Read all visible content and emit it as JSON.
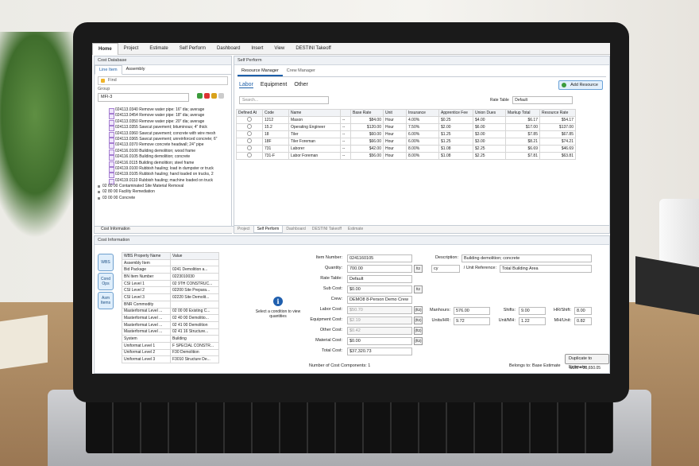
{
  "ribbon": {
    "tabs": [
      "Home",
      "Project",
      "Estimate",
      "Self Perform",
      "Dashboard",
      "Insert",
      "View",
      "DESTINI Takeoff"
    ],
    "active": "Home"
  },
  "cost_database": {
    "title": "Cost Database",
    "tabs": [
      "Line Item",
      "Assembly"
    ],
    "find_label": "Find",
    "group_label": "Group",
    "group_value": "MFI-3",
    "tree": [
      "024113.0340 Remove water pipe: 16\" dia; average",
      "024113.0454 Remove water pipe: 18\" dia; average",
      "024113.0350 Remove water pipe: 20\" dia; average",
      "024113.0355 Sawcut pavement; bituminous; 4\" thick",
      "024113.0360 Sawcut pavement; concrete with wire mesh",
      "024113.0365 Sawcut pavement; unreinforced concrete; 6\"",
      "024113.0370 Remove concrete headwall; 24\" pipe",
      "024116.0100 Building demolition; wood frame",
      "024116.0105 Building demolition; concrete",
      "024116.0115 Building demolition; steel frame",
      "024119.0100 Rubbish hauling; load in dumpster or truck",
      "024119.0105 Rubbish hauling; hand loaded on trucks, 2",
      "024119.0110 Rubbish hauling; machine loaded on truck"
    ],
    "folders": [
      "02 60 00 Contaminated Site Material Removal",
      "02 80 00 Facility Remediation",
      "03 00 00 Concrete"
    ],
    "footer": "Cost Information"
  },
  "self_perform": {
    "title": "Self Perform",
    "tabs": [
      "Resource Manager",
      "Crew Manager"
    ],
    "categories": [
      "Labor",
      "Equipment",
      "Other"
    ],
    "add_resource": "Add Resource",
    "search_placeholder": "Search...",
    "rate_table_label": "Rate Table",
    "rate_table_value": "Default",
    "columns": [
      "Defined At",
      "Code",
      "Name",
      "",
      "Base Rate",
      "Unit",
      "Insurance",
      "Apprentice Fee",
      "Union Dues",
      "Markup Total",
      "Resource Rate"
    ],
    "rows": [
      [
        "",
        "1212",
        "Mason",
        "--",
        "$84.00",
        "Hour",
        "4.00%",
        "$0.25",
        "$4.00",
        "$6.17",
        "$54.17"
      ],
      [
        "",
        "15.2",
        "Operating Engineer",
        "--",
        "$120.00",
        "Hour",
        "7.50%",
        "$2.00",
        "$6.00",
        "$17.00",
        "$137.00"
      ],
      [
        "",
        "18",
        "Tiler",
        "--",
        "$60.00",
        "Hour",
        "6.00%",
        "$1.25",
        "$3.00",
        "$7.85",
        "$67.85"
      ],
      [
        "",
        "18F",
        "Tiler Foreman",
        "--",
        "$66.00",
        "Hour",
        "6.00%",
        "$1.25",
        "$3.00",
        "$8.21",
        "$74.21"
      ],
      [
        "",
        "731",
        "Laborer",
        "--",
        "$42.00",
        "Hour",
        "8.00%",
        "$1.08",
        "$2.25",
        "$6.69",
        "$46.69"
      ],
      [
        "",
        "731-F",
        "Labor Foreman",
        "--",
        "$56.00",
        "Hour",
        "8.00%",
        "$1.08",
        "$2.25",
        "$7.81",
        "$63.81"
      ]
    ],
    "bottom_tabs": [
      "Project",
      "Self Perform",
      "Dashboard",
      "DESTINI Takeoff",
      "Estimate"
    ]
  },
  "cost_information": {
    "title": "Cost Information",
    "side_buttons": [
      "WBS",
      "Cond Ops",
      "Asm Items"
    ],
    "wbs_columns": [
      "WBS Property Name",
      "Value"
    ],
    "wbs_rows": [
      [
        "Assembly Item",
        ""
      ],
      [
        "Bid Package",
        "0241 Demolition a..."
      ],
      [
        "BN Item Number",
        "0223010030"
      ],
      [
        "CSI Level 1",
        "02 9TH CONSTRUC..."
      ],
      [
        "CSI Level 2",
        "02200 Site Prepara..."
      ],
      [
        "CSI Level 3",
        "02220 Site Demolit..."
      ],
      [
        "BNR Commodity",
        ""
      ],
      [
        "Masterformat Level ...",
        "02 00 00 Existing C..."
      ],
      [
        "Masterformat Level ...",
        "02 40 00 Demolitio..."
      ],
      [
        "Masterformat Level ...",
        "02 41 00 Demolition"
      ],
      [
        "Masterformat Level ...",
        "02 41 16 Structure..."
      ],
      [
        "System",
        "Building"
      ],
      [
        "Uniformat Level 1",
        "F SPECIAL CONSTR..."
      ],
      [
        "Uniformat Level 2",
        "F30 Demolition"
      ],
      [
        "Uniformat Level 3",
        "F3010 Structure De..."
      ]
    ],
    "condition_prompt": "Select a condition to view quantities",
    "item_number_label": "Item Number:",
    "item_number": "0241160105",
    "quantity_label": "Quantity:",
    "quantity": "700.00",
    "quantity_unit": "ft2",
    "rate_table_label": "Rate Table:",
    "rate_table": "Default",
    "sub_cost_label": "Sub Cost:",
    "sub_cost": "$0.00",
    "sub_cost_unit": "ft2",
    "crew_label": "Crew:",
    "crew": "DEMO8 8-Person Demo Crew",
    "labor_cost_label": "Labor Cost:",
    "labor_cost": "$50.70",
    "equipment_cost_label": "Equipment Cost:",
    "equipment_cost": "$2.19",
    "other_cost_label": "Other Cost:",
    "other_cost": "$0.42",
    "material_cost_label": "Material Cost:",
    "material_cost": "$0.00",
    "total_cost_label": "Total Cost:",
    "total_cost": "$37,320.73",
    "cost_unit": "(ft2)",
    "description_label": "Description:",
    "description": "Building demolition; concrete",
    "unit_ref_value": "cy",
    "unit_ref_label": "/ Unit Reference:",
    "unit_ref": "Total Building Area",
    "manhours_label": "Manhours:",
    "manhours": "576.00",
    "shifts_label": "Shifts:",
    "shifts": "9.00",
    "hr_shift_label": "HR/Shift:",
    "hr_shift": "8.00",
    "units_hr_label": "Units/HR:",
    "units_hr": "9.72",
    "unit_mh_label": "Unit/MH:",
    "unit_mh": "1.22",
    "mh_unit_label": "MH/Unit:",
    "mh_unit": "0.82",
    "components": "Number of Cost Components:  1",
    "belongs_to": "Belongs to: Base Estimate",
    "duplicate": "Duplicate to Estimate",
    "sum": "SUM = 38,650.05"
  }
}
